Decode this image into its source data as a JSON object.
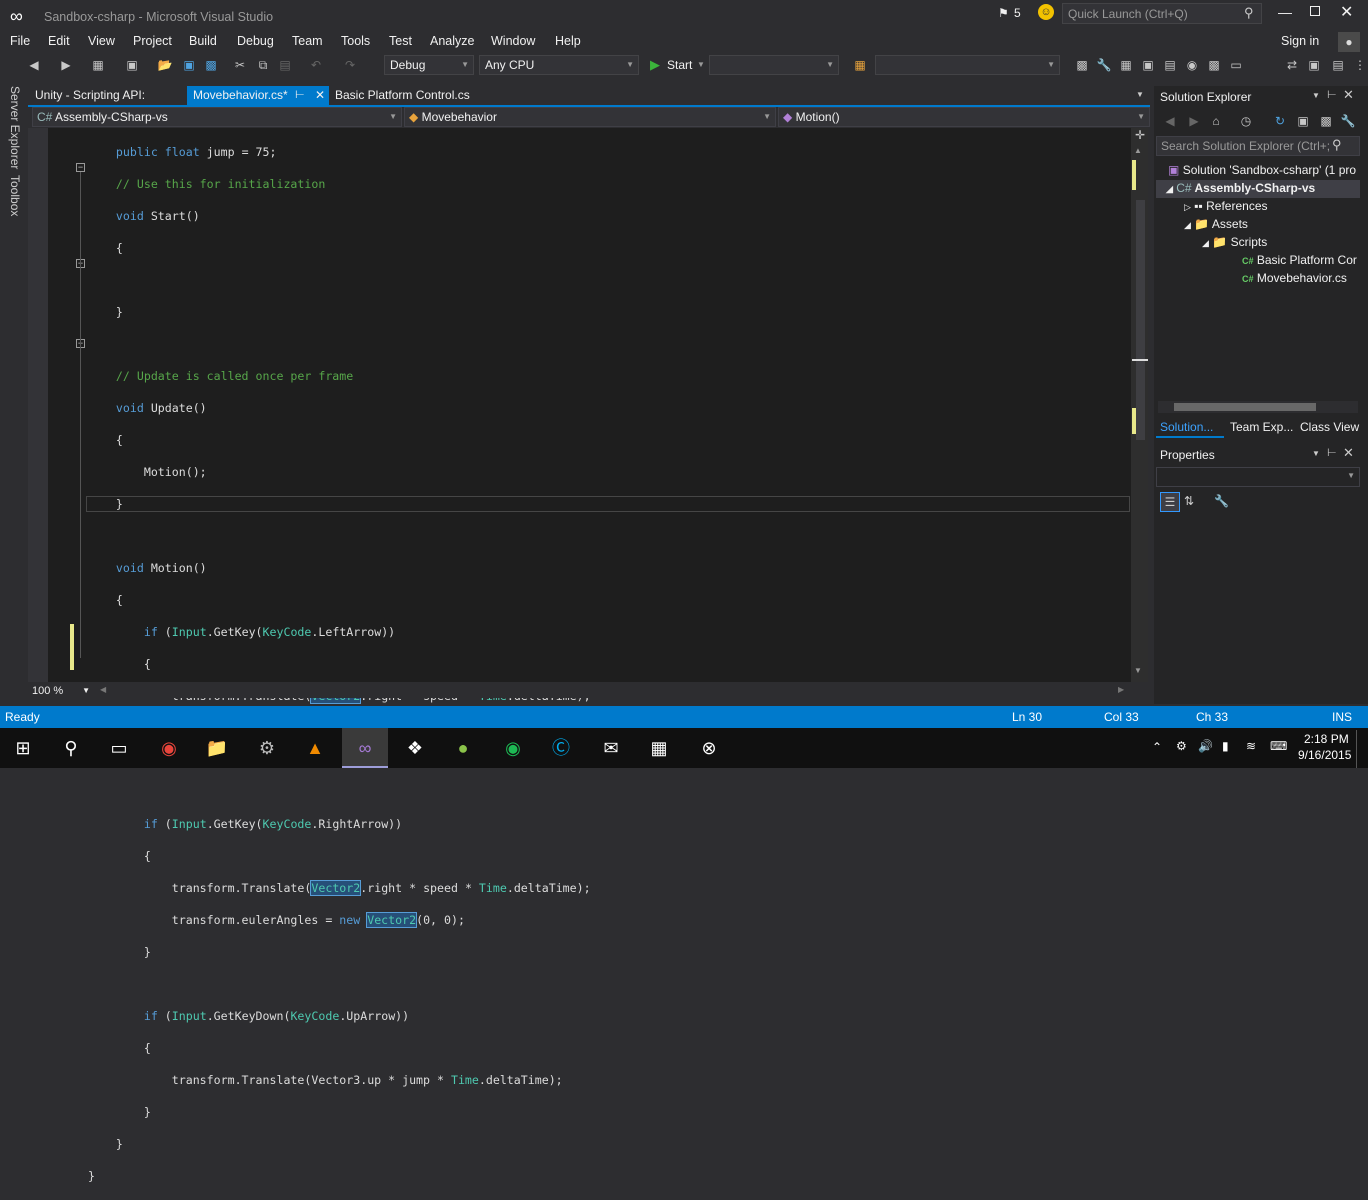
{
  "window": {
    "title": "Sandbox-csharp - Microsoft Visual Studio",
    "notifications": "5",
    "quick_launch_placeholder": "Quick Launch (Ctrl+Q)",
    "sign_in": "Sign in"
  },
  "menu": [
    "File",
    "Edit",
    "View",
    "Project",
    "Build",
    "Debug",
    "Team",
    "Tools",
    "Test",
    "Analyze",
    "Window",
    "Help"
  ],
  "toolbar": {
    "config": "Debug",
    "platform": "Any CPU",
    "start": "Start"
  },
  "left_rail": {
    "server_explorer": "Server Explorer",
    "toolbox": "Toolbox"
  },
  "tabs": [
    {
      "label": "Unity - Scripting API:"
    },
    {
      "label": "Movebehavior.cs*"
    },
    {
      "label": "Basic Platform Control.cs"
    }
  ],
  "navbar": {
    "project": "Assembly-CSharp-vs",
    "class": "Movebehavior",
    "member": "Motion()"
  },
  "zoom": "100 %",
  "solution_explorer": {
    "title": "Solution Explorer",
    "search_placeholder": "Search Solution Explorer (Ctrl+;",
    "items": [
      {
        "label": "Solution 'Sandbox-csharp' (1 pro"
      },
      {
        "label": "Assembly-CSharp-vs"
      },
      {
        "label": "References"
      },
      {
        "label": "Assets"
      },
      {
        "label": "Scripts"
      },
      {
        "label": "Basic Platform Cor"
      },
      {
        "label": "Movebehavior.cs"
      }
    ],
    "tabs": [
      "Solution...",
      "Team Exp...",
      "Class View"
    ]
  },
  "properties": {
    "title": "Properties"
  },
  "status": {
    "state": "Ready",
    "ln": "Ln 30",
    "col": "Col 33",
    "ch": "Ch 33",
    "mode": "INS"
  },
  "clock": {
    "time": "2:18 PM",
    "date": "9/16/2015"
  }
}
